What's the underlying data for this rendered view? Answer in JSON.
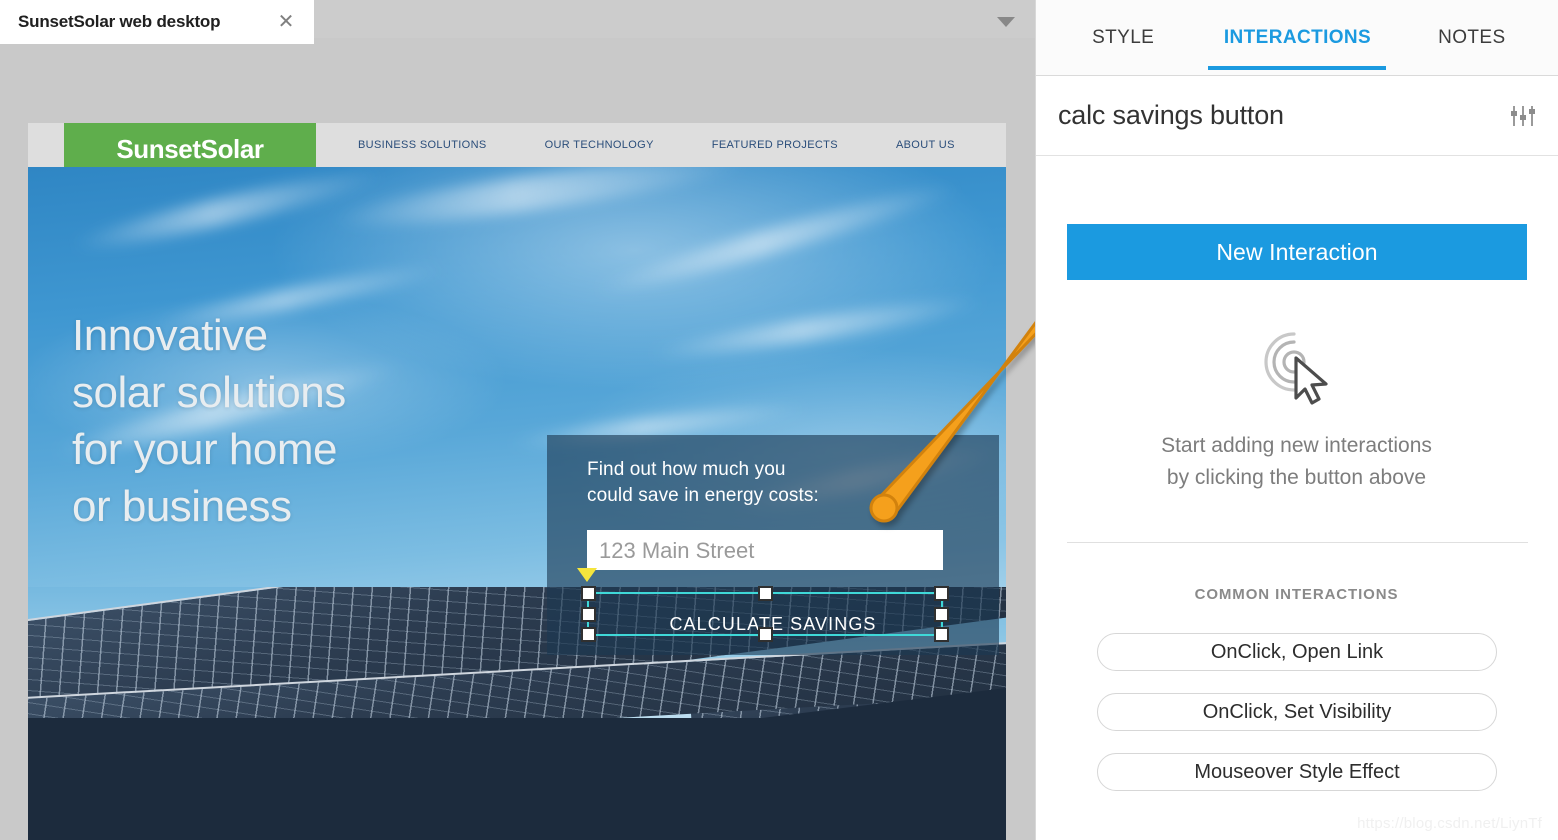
{
  "editor": {
    "document_tab": {
      "title": "SunsetSolar web desktop",
      "close_icon": "close-icon"
    },
    "tabbar_chevron_icon": "chevron-down-icon"
  },
  "website": {
    "logo": "SunsetSolar",
    "nav": [
      "BUSINESS SOLUTIONS",
      "OUR TECHNOLOGY",
      "FEATURED PROJECTS",
      "ABOUT US"
    ],
    "headline": "Innovative\nsolar solutions\nfor your home\nor business",
    "form": {
      "prompt": "Find out how much you\ncould save in energy costs:",
      "address_placeholder": "123 Main Street",
      "cta_label": "CALCULATE SAVINGS"
    }
  },
  "selection": {
    "marker_icon": "selection-origin-marker",
    "handle_icon": "resize-handle"
  },
  "annotation": {
    "arrow_icon": "orange-arrow",
    "arrow_color": "#F5A01E"
  },
  "panel": {
    "tabs": [
      {
        "label": "STYLE",
        "active": false
      },
      {
        "label": "INTERACTIONS",
        "active": true
      },
      {
        "label": "NOTES",
        "active": false
      }
    ],
    "element_name": "calc savings button",
    "settings_icon": "sliders-icon",
    "new_interaction_label": "New Interaction",
    "empty_state_icon": "click-cursor-icon",
    "empty_state_text": "Start adding new interactions\nby clicking the button above",
    "common_interactions_title": "COMMON INTERACTIONS",
    "common_interactions": [
      "OnClick, Open Link",
      "OnClick, Set Visibility",
      "Mouseover Style Effect"
    ],
    "accent_color": "#1B9AE0"
  },
  "watermark": "https://blog.csdn.net/LiynTf"
}
